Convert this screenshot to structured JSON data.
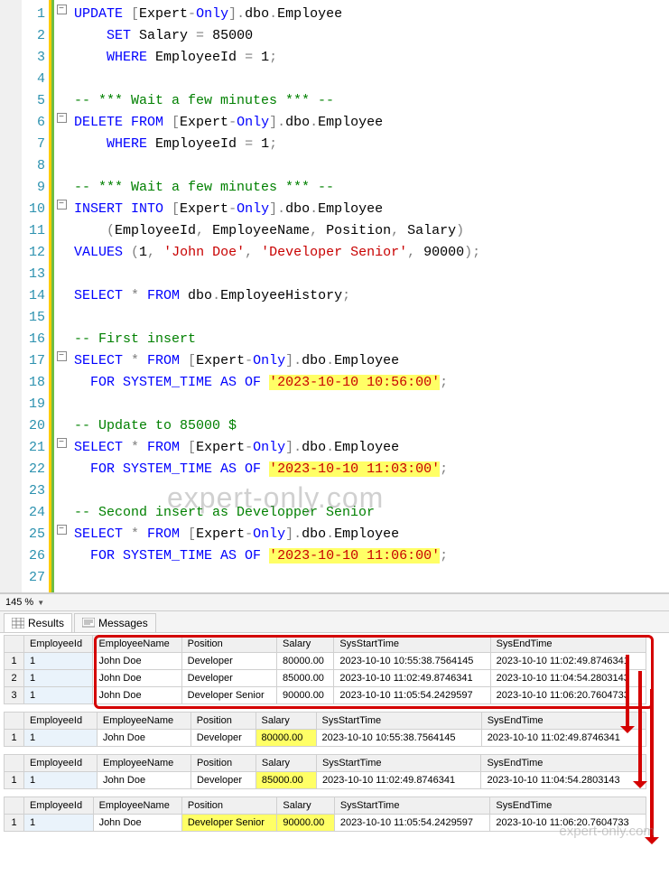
{
  "zoom_level": "145 %",
  "tabs": {
    "results": "Results",
    "messages": "Messages"
  },
  "code": {
    "lines": [
      {
        "n": 1,
        "fold": "box",
        "seg": [
          {
            "c": "kw",
            "t": "UPDATE"
          },
          {
            "c": "op",
            "t": " ["
          },
          {
            "c": "id",
            "t": "Expert"
          },
          {
            "c": "op",
            "t": "-"
          },
          {
            "c": "kw",
            "t": "Only"
          },
          {
            "c": "op",
            "t": "]."
          },
          {
            "c": "id",
            "t": "dbo"
          },
          {
            "c": "op",
            "t": "."
          },
          {
            "c": "id",
            "t": "Employee"
          }
        ]
      },
      {
        "n": 2,
        "seg": [
          {
            "c": "id",
            "t": "    "
          },
          {
            "c": "kw",
            "t": "SET"
          },
          {
            "c": "id",
            "t": " Salary "
          },
          {
            "c": "op",
            "t": "= "
          },
          {
            "c": "num",
            "t": "85000"
          }
        ]
      },
      {
        "n": 3,
        "seg": [
          {
            "c": "id",
            "t": "    "
          },
          {
            "c": "kw",
            "t": "WHERE"
          },
          {
            "c": "id",
            "t": " EmployeeId "
          },
          {
            "c": "op",
            "t": "= "
          },
          {
            "c": "num",
            "t": "1"
          },
          {
            "c": "op",
            "t": ";"
          }
        ]
      },
      {
        "n": 4,
        "seg": []
      },
      {
        "n": 5,
        "seg": [
          {
            "c": "cm",
            "t": "-- *** Wait a few minutes *** --"
          }
        ]
      },
      {
        "n": 6,
        "fold": "box",
        "seg": [
          {
            "c": "kw",
            "t": "DELETE FROM"
          },
          {
            "c": "op",
            "t": " ["
          },
          {
            "c": "id",
            "t": "Expert"
          },
          {
            "c": "op",
            "t": "-"
          },
          {
            "c": "kw",
            "t": "Only"
          },
          {
            "c": "op",
            "t": "]."
          },
          {
            "c": "id",
            "t": "dbo"
          },
          {
            "c": "op",
            "t": "."
          },
          {
            "c": "id",
            "t": "Employee"
          }
        ]
      },
      {
        "n": 7,
        "seg": [
          {
            "c": "id",
            "t": "    "
          },
          {
            "c": "kw",
            "t": "WHERE"
          },
          {
            "c": "id",
            "t": " EmployeeId "
          },
          {
            "c": "op",
            "t": "= "
          },
          {
            "c": "num",
            "t": "1"
          },
          {
            "c": "op",
            "t": ";"
          }
        ]
      },
      {
        "n": 8,
        "seg": []
      },
      {
        "n": 9,
        "seg": [
          {
            "c": "cm",
            "t": "-- *** Wait a few minutes *** --"
          }
        ]
      },
      {
        "n": 10,
        "fold": "box",
        "seg": [
          {
            "c": "kw",
            "t": "INSERT INTO"
          },
          {
            "c": "op",
            "t": " ["
          },
          {
            "c": "id",
            "t": "Expert"
          },
          {
            "c": "op",
            "t": "-"
          },
          {
            "c": "kw",
            "t": "Only"
          },
          {
            "c": "op",
            "t": "]."
          },
          {
            "c": "id",
            "t": "dbo"
          },
          {
            "c": "op",
            "t": "."
          },
          {
            "c": "id",
            "t": "Employee"
          }
        ]
      },
      {
        "n": 11,
        "seg": [
          {
            "c": "id",
            "t": "    "
          },
          {
            "c": "op",
            "t": "("
          },
          {
            "c": "id",
            "t": "EmployeeId"
          },
          {
            "c": "op",
            "t": ", "
          },
          {
            "c": "id",
            "t": "EmployeeName"
          },
          {
            "c": "op",
            "t": ", "
          },
          {
            "c": "id",
            "t": "Position"
          },
          {
            "c": "op",
            "t": ", "
          },
          {
            "c": "id",
            "t": "Salary"
          },
          {
            "c": "op",
            "t": ")"
          }
        ]
      },
      {
        "n": 12,
        "seg": [
          {
            "c": "kw",
            "t": "VALUES"
          },
          {
            "c": "op",
            "t": " ("
          },
          {
            "c": "num",
            "t": "1"
          },
          {
            "c": "op",
            "t": ", "
          },
          {
            "c": "str",
            "t": "'John Doe'"
          },
          {
            "c": "op",
            "t": ", "
          },
          {
            "c": "str",
            "t": "'Developer Senior'"
          },
          {
            "c": "op",
            "t": ", "
          },
          {
            "c": "num",
            "t": "90000"
          },
          {
            "c": "op",
            "t": ");"
          }
        ]
      },
      {
        "n": 13,
        "seg": []
      },
      {
        "n": 14,
        "seg": [
          {
            "c": "kw",
            "t": "SELECT"
          },
          {
            "c": "op",
            "t": " * "
          },
          {
            "c": "kw",
            "t": "FROM"
          },
          {
            "c": "id",
            "t": " dbo"
          },
          {
            "c": "op",
            "t": "."
          },
          {
            "c": "id",
            "t": "EmployeeHistory"
          },
          {
            "c": "op",
            "t": ";"
          }
        ]
      },
      {
        "n": 15,
        "seg": []
      },
      {
        "n": 16,
        "seg": [
          {
            "c": "cm",
            "t": "-- First insert"
          }
        ]
      },
      {
        "n": 17,
        "fold": "box",
        "seg": [
          {
            "c": "kw",
            "t": "SELECT"
          },
          {
            "c": "op",
            "t": " * "
          },
          {
            "c": "kw",
            "t": "FROM"
          },
          {
            "c": "op",
            "t": " ["
          },
          {
            "c": "id",
            "t": "Expert"
          },
          {
            "c": "op",
            "t": "-"
          },
          {
            "c": "kw",
            "t": "Only"
          },
          {
            "c": "op",
            "t": "]."
          },
          {
            "c": "id",
            "t": "dbo"
          },
          {
            "c": "op",
            "t": "."
          },
          {
            "c": "id",
            "t": "Employee"
          }
        ]
      },
      {
        "n": 18,
        "seg": [
          {
            "c": "id",
            "t": "  "
          },
          {
            "c": "kw",
            "t": "FOR SYSTEM_TIME AS OF "
          },
          {
            "c": "strhl",
            "t": "'2023-10-10 10:56:00'"
          },
          {
            "c": "op",
            "t": ";"
          }
        ]
      },
      {
        "n": 19,
        "seg": []
      },
      {
        "n": 20,
        "seg": [
          {
            "c": "cm",
            "t": "-- Update to 85000 $"
          }
        ]
      },
      {
        "n": 21,
        "fold": "box",
        "seg": [
          {
            "c": "kw",
            "t": "SELECT"
          },
          {
            "c": "op",
            "t": " * "
          },
          {
            "c": "kw",
            "t": "FROM"
          },
          {
            "c": "op",
            "t": " ["
          },
          {
            "c": "id",
            "t": "Expert"
          },
          {
            "c": "op",
            "t": "-"
          },
          {
            "c": "kw",
            "t": "Only"
          },
          {
            "c": "op",
            "t": "]."
          },
          {
            "c": "id",
            "t": "dbo"
          },
          {
            "c": "op",
            "t": "."
          },
          {
            "c": "id",
            "t": "Employee"
          }
        ]
      },
      {
        "n": 22,
        "seg": [
          {
            "c": "id",
            "t": "  "
          },
          {
            "c": "kw",
            "t": "FOR SYSTEM_TIME AS OF "
          },
          {
            "c": "strhl",
            "t": "'2023-10-10 11:03:00'"
          },
          {
            "c": "op",
            "t": ";"
          }
        ]
      },
      {
        "n": 23,
        "seg": []
      },
      {
        "n": 24,
        "seg": [
          {
            "c": "cm",
            "t": "-- Second insert as Developper Senior"
          }
        ]
      },
      {
        "n": 25,
        "fold": "box",
        "seg": [
          {
            "c": "kw",
            "t": "SELECT"
          },
          {
            "c": "op",
            "t": " * "
          },
          {
            "c": "kw",
            "t": "FROM"
          },
          {
            "c": "op",
            "t": " ["
          },
          {
            "c": "id",
            "t": "Expert"
          },
          {
            "c": "op",
            "t": "-"
          },
          {
            "c": "kw",
            "t": "Only"
          },
          {
            "c": "op",
            "t": "]."
          },
          {
            "c": "id",
            "t": "dbo"
          },
          {
            "c": "op",
            "t": "."
          },
          {
            "c": "id",
            "t": "Employee"
          }
        ]
      },
      {
        "n": 26,
        "seg": [
          {
            "c": "id",
            "t": "  "
          },
          {
            "c": "kw",
            "t": "FOR SYSTEM_TIME AS OF "
          },
          {
            "c": "strhl",
            "t": "'2023-10-10 11:06:00'"
          },
          {
            "c": "op",
            "t": ";"
          }
        ]
      },
      {
        "n": 27,
        "seg": []
      }
    ]
  },
  "columns": [
    "EmployeeId",
    "EmployeeName",
    "Position",
    "Salary",
    "SysStartTime",
    "SysEndTime"
  ],
  "grids": [
    {
      "highlight_cols": [],
      "rows": [
        {
          "n": "1",
          "c": [
            "1",
            "John Doe",
            "Developer",
            "80000.00",
            "2023-10-10 10:55:38.7564145",
            "2023-10-10 11:02:49.8746341"
          ]
        },
        {
          "n": "2",
          "c": [
            "1",
            "John Doe",
            "Developer",
            "85000.00",
            "2023-10-10 11:02:49.8746341",
            "2023-10-10 11:04:54.2803143"
          ]
        },
        {
          "n": "3",
          "c": [
            "1",
            "John Doe",
            "Developer Senior",
            "90000.00",
            "2023-10-10 11:05:54.2429597",
            "2023-10-10 11:06:20.7604733"
          ]
        }
      ]
    },
    {
      "highlight_cols": [
        3
      ],
      "rows": [
        {
          "n": "1",
          "c": [
            "1",
            "John Doe",
            "Developer",
            "80000.00",
            "2023-10-10 10:55:38.7564145",
            "2023-10-10 11:02:49.8746341"
          ]
        }
      ]
    },
    {
      "highlight_cols": [
        3
      ],
      "rows": [
        {
          "n": "1",
          "c": [
            "1",
            "John Doe",
            "Developer",
            "85000.00",
            "2023-10-10 11:02:49.8746341",
            "2023-10-10 11:04:54.2803143"
          ]
        }
      ]
    },
    {
      "highlight_cols": [
        2,
        3
      ],
      "rows": [
        {
          "n": "1",
          "c": [
            "1",
            "John Doe",
            "Developer Senior",
            "90000.00",
            "2023-10-10 11:05:54.2429597",
            "2023-10-10 11:06:20.7604733"
          ]
        }
      ]
    }
  ],
  "watermark": "expert-only.com",
  "watermark2": "expert-only.com"
}
